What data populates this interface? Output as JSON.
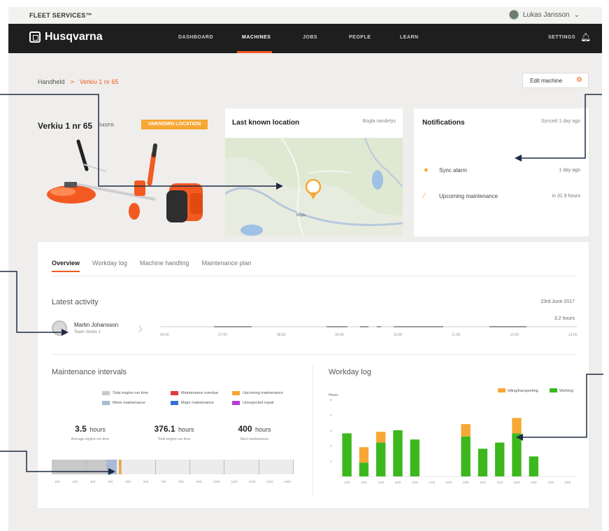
{
  "topbar": {
    "brand": "FLEET SERVICES™",
    "user": "Lukas Jansson"
  },
  "nav": {
    "logo": "Husqvarna",
    "items": [
      "DASHBOARD",
      "MACHINES",
      "JOBS",
      "PEOPLE",
      "LEARN"
    ],
    "active": "MACHINES",
    "settings": "SETTINGS"
  },
  "breadcrumb": {
    "parent": "Handheld",
    "separator": ">",
    "current": "Verkiu 1 nr 65"
  },
  "edit_button": "Edit machine",
  "machine": {
    "title": "Verkiu 1 nr 65",
    "id": "545FR",
    "location_badge": "UNKNOWN LOCATION"
  },
  "location_card": {
    "title": "Last known location",
    "subtitle": "Bogla sandelys",
    "map_label": "Bogla"
  },
  "notifications": {
    "title": "Notifications",
    "subtitle": "Synced 1 day ago",
    "items": [
      {
        "icon": "location-pin-icon",
        "label": "Sync alarm",
        "time": "1 day ago"
      },
      {
        "icon": "wrench-icon",
        "label": "Upcoming maintenance",
        "time": "in 31.9 hours"
      }
    ]
  },
  "tabs": [
    "Overview",
    "Workday log",
    "Machine handling",
    "Maintenance plan"
  ],
  "activity": {
    "title": "Latest activity",
    "date": "23rd June 2017",
    "hours": "3.2 hours",
    "operator_name": "Martin Johansson",
    "operator_sub": "Team Verkiu 1",
    "ticks": [
      "06:00",
      "07:00",
      "08:00",
      "09:00",
      "10:00",
      "11:00",
      "12:00",
      "13:00"
    ],
    "segments": [
      [
        0.13,
        0.22
      ],
      [
        0.4,
        0.45
      ],
      [
        0.48,
        0.5
      ],
      [
        0.52,
        0.53
      ],
      [
        0.56,
        0.68
      ],
      [
        0.79,
        0.88
      ]
    ]
  },
  "maintenance": {
    "title": "Maintenance intervals",
    "legend": [
      {
        "label": "Total engine run time",
        "color": "#c9c9c9"
      },
      {
        "label": "Maintenance overdue",
        "color": "#e03a3a"
      },
      {
        "label": "Upcoming maintenance",
        "color": "#f7a734"
      },
      {
        "label": "Minor maintenance",
        "color": "#a9b9d6"
      },
      {
        "label": "Major maintenance",
        "color": "#3a6fd6"
      },
      {
        "label": "Unexpected repair",
        "color": "#b73ad6"
      }
    ],
    "stats": [
      {
        "value": "3.5",
        "unit": "hours",
        "label": "Average engine run time"
      },
      {
        "value": "376.1",
        "unit": "hours",
        "label": "Total engine run time"
      },
      {
        "value": "400",
        "unit": "hours",
        "label": "Next maintenance"
      }
    ],
    "axis": [
      "100",
      "200",
      "300",
      "400",
      "500",
      "600",
      "700",
      "800",
      "900",
      "1000",
      "1100",
      "1200",
      "1300",
      "1400"
    ],
    "run_time_hours": 376.1,
    "next_maintenance_hours": 400,
    "axis_max": 1400
  },
  "workday": {
    "title": "Workday log",
    "ylabel": "Hours",
    "legend": [
      {
        "label": "Idling/transporting",
        "color": "#f7a734"
      },
      {
        "label": "Working",
        "color": "#3cb81e"
      }
    ]
  },
  "chart_data": {
    "type": "bar",
    "stacked": true,
    "ylabel": "Hours",
    "ylim": [
      0,
      5
    ],
    "yticks": [
      1,
      2,
      3,
      4,
      5
    ],
    "categories": [
      "12/6",
      "13/6",
      "14/6",
      "15/6",
      "16/6",
      "17/6",
      "18/6",
      "19/6",
      "20/6",
      "21/6",
      "22/6",
      "23/6",
      "24/6",
      "25/6"
    ],
    "series": [
      {
        "name": "Working",
        "color": "#3cb81e",
        "values": [
          2.8,
          0.9,
          2.2,
          3.0,
          2.4,
          0,
          0,
          2.6,
          1.8,
          2.2,
          2.8,
          1.3,
          0,
          0
        ]
      },
      {
        "name": "Idling/transporting",
        "color": "#f7a734",
        "values": [
          0,
          1.0,
          0.7,
          0,
          0,
          0,
          0,
          0.8,
          0,
          0,
          1.0,
          0,
          0,
          0
        ]
      }
    ]
  }
}
